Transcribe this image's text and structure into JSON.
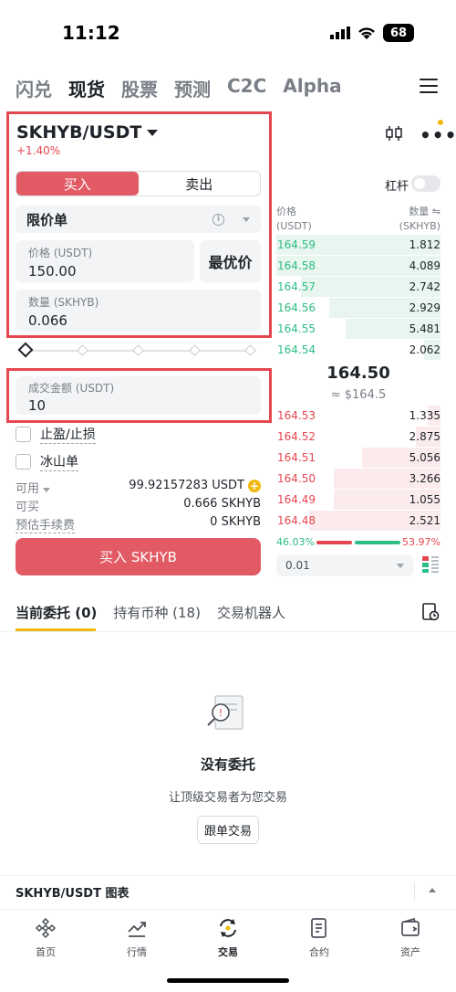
{
  "status": {
    "time": "11:12",
    "battery": "68"
  },
  "top_tabs": [
    "闪兑",
    "现货",
    "股票",
    "预测",
    "C2C",
    "Alpha"
  ],
  "pair": {
    "name": "SKHYB/USDT",
    "change": "+1.40%"
  },
  "order_form": {
    "buy_label": "买入",
    "sell_label": "卖出",
    "order_type": "限价单",
    "price_label": "价格 (USDT)",
    "price_value": "150.00",
    "best_price_label": "最优价",
    "qty_label": "数量 (SKHYB)",
    "qty_value": "0.066",
    "amount_label": "成交金额 (USDT)",
    "amount_value": "10",
    "tp_sl_label": "止盈/止损",
    "iceberg_label": "冰山单",
    "available_label": "可用",
    "available_value": "99.92157283 USDT",
    "can_buy_label": "可买",
    "can_buy_value": "0.666 SKHYB",
    "fee_label": "预估手续费",
    "fee_value": "0 SKHYB",
    "submit_label": "买入 SKHYB"
  },
  "order_book": {
    "leverage_label": "杠杆",
    "price_col": "价格",
    "price_unit": "(USDT)",
    "qty_col": "数量 ⇋",
    "qty_unit": "(SKHYB)",
    "bids_top": [
      {
        "price": "164.59",
        "qty": "1.812",
        "depth": 1.0
      },
      {
        "price": "164.58",
        "qty": "4.089",
        "depth": 1.0
      },
      {
        "price": "164.57",
        "qty": "2.742",
        "depth": 0.85
      },
      {
        "price": "164.56",
        "qty": "2.929",
        "depth": 0.68
      },
      {
        "price": "164.55",
        "qty": "5.481",
        "depth": 0.58
      },
      {
        "price": "164.54",
        "qty": "2.062",
        "depth": 0.1
      }
    ],
    "mid_price": "164.50",
    "mid_sub": "≈ $164.5",
    "asks": [
      {
        "price": "164.53",
        "qty": "1.335",
        "depth": 0.08
      },
      {
        "price": "164.52",
        "qty": "2.875",
        "depth": 0.15
      },
      {
        "price": "164.51",
        "qty": "5.056",
        "depth": 0.48
      },
      {
        "price": "164.50",
        "qty": "3.266",
        "depth": 0.65
      },
      {
        "price": "164.49",
        "qty": "1.055",
        "depth": 0.65
      },
      {
        "price": "164.48",
        "qty": "2.521",
        "depth": 0.8
      }
    ],
    "buy_ratio": "46.03%",
    "sell_ratio": "53.97%",
    "tick": "0.01"
  },
  "bottom_tabs": [
    "当前委托 (0)",
    "持有币种 (18)",
    "交易机器人"
  ],
  "empty": {
    "title": "没有委托",
    "subtitle": "让顶级交易者为您交易",
    "button": "跟单交易"
  },
  "chart_bar": "SKHYB/USDT 图表",
  "nav": [
    "首页",
    "行情",
    "交易",
    "合约",
    "资产"
  ],
  "colors": {
    "red": "#e5464f",
    "green": "#2ebd85",
    "yellow": "#f0b90b"
  }
}
